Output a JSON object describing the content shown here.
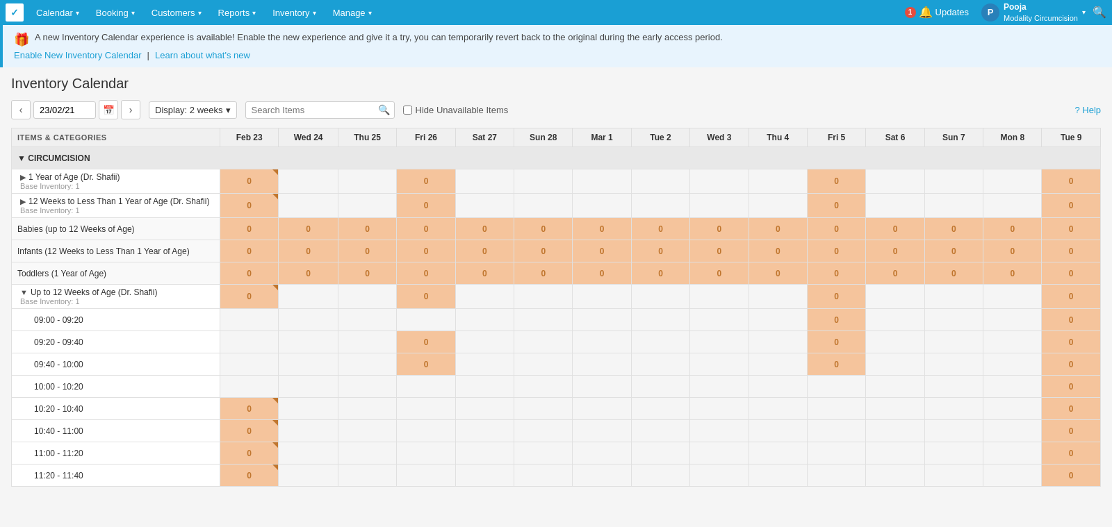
{
  "nav": {
    "logo": "✓",
    "items": [
      {
        "label": "Calendar",
        "id": "calendar"
      },
      {
        "label": "Booking",
        "id": "booking"
      },
      {
        "label": "Customers",
        "id": "customers"
      },
      {
        "label": "Reports",
        "id": "reports"
      },
      {
        "label": "Inventory",
        "id": "inventory"
      },
      {
        "label": "Manage",
        "id": "manage"
      }
    ],
    "updates_label": "Updates",
    "updates_count": "1",
    "user_name": "Pooja",
    "user_org": "Modality Circumcision",
    "user_initial": "P"
  },
  "banner": {
    "message": "A new Inventory Calendar experience is available! Enable the new experience and give it a try, you can temporarily revert back to the original during the early access period.",
    "link1": "Enable New Inventory Calendar",
    "separator": "|",
    "link2": "Learn about what's new"
  },
  "page": {
    "title": "Inventory Calendar",
    "date_value": "23/02/21",
    "display_label": "Display: 2 weeks",
    "search_placeholder": "Search Items",
    "hide_label": "Hide Unavailable Items",
    "help_label": "? Help"
  },
  "calendar": {
    "column_headers": [
      {
        "label": "ITEMS & CATEGORIES",
        "id": "items-col"
      },
      {
        "label": "Feb 23",
        "id": "feb23"
      },
      {
        "label": "Wed 24",
        "id": "wed24"
      },
      {
        "label": "Thu 25",
        "id": "thu25"
      },
      {
        "label": "Fri 26",
        "id": "fri26"
      },
      {
        "label": "Sat 27",
        "id": "sat27"
      },
      {
        "label": "Sun 28",
        "id": "sun28"
      },
      {
        "label": "Mar 1",
        "id": "mar1"
      },
      {
        "label": "Tue 2",
        "id": "tue2"
      },
      {
        "label": "Wed 3",
        "id": "wed3"
      },
      {
        "label": "Thu 4",
        "id": "thu4"
      },
      {
        "label": "Fri 5",
        "id": "fri5"
      },
      {
        "label": "Sat 6",
        "id": "sat6"
      },
      {
        "label": "Sun 7",
        "id": "sun7"
      },
      {
        "label": "Mon 8",
        "id": "mon8"
      },
      {
        "label": "Tue 9",
        "id": "tue9"
      }
    ],
    "category": "CIRCUMCISION",
    "rows": [
      {
        "type": "item",
        "name": "1 Year of Age (Dr. Shafii)",
        "base": "Base Inventory: 1",
        "expandable": true,
        "cells": [
          "0",
          "",
          "",
          "0",
          "",
          "",
          "",
          "",
          "",
          "",
          "0",
          "",
          "",
          "",
          "0"
        ],
        "orange": [
          0,
          3,
          10,
          14
        ],
        "corner": [
          0
        ]
      },
      {
        "type": "item",
        "name": "12 Weeks to Less Than 1 Year of Age (Dr. Shafii)",
        "base": "Base Inventory: 1",
        "expandable": true,
        "cells": [
          "0",
          "",
          "",
          "0",
          "",
          "",
          "",
          "",
          "",
          "",
          "0",
          "",
          "",
          "",
          "0"
        ],
        "orange": [
          0,
          3,
          10,
          14
        ],
        "corner": [
          0
        ]
      },
      {
        "type": "sub",
        "name": "Babies (up to 12 Weeks of Age)",
        "cells": [
          "0",
          "0",
          "0",
          "0",
          "0",
          "0",
          "0",
          "0",
          "0",
          "0",
          "0",
          "0",
          "0",
          "0",
          "0"
        ],
        "orange": [
          0,
          1,
          2,
          3,
          4,
          5,
          6,
          7,
          8,
          9,
          10,
          11,
          12,
          13,
          14
        ],
        "corner": []
      },
      {
        "type": "sub",
        "name": "Infants (12 Weeks to Less Than 1 Year of Age)",
        "cells": [
          "0",
          "0",
          "0",
          "0",
          "0",
          "0",
          "0",
          "0",
          "0",
          "0",
          "0",
          "0",
          "0",
          "0",
          "0"
        ],
        "orange": [
          0,
          1,
          2,
          3,
          4,
          5,
          6,
          7,
          8,
          9,
          10,
          11,
          12,
          13,
          14
        ],
        "corner": []
      },
      {
        "type": "sub",
        "name": "Toddlers (1 Year of Age)",
        "cells": [
          "0",
          "0",
          "0",
          "0",
          "0",
          "0",
          "0",
          "0",
          "0",
          "0",
          "0",
          "0",
          "0",
          "0",
          "0"
        ],
        "orange": [
          0,
          1,
          2,
          3,
          4,
          5,
          6,
          7,
          8,
          9,
          10,
          11,
          12,
          13,
          14
        ],
        "corner": []
      },
      {
        "type": "item",
        "name": "Up to 12 Weeks of Age (Dr. Shafii)",
        "base": "Base Inventory: 1",
        "expandable": true,
        "expanded": true,
        "cells": [
          "0",
          "",
          "",
          "0",
          "",
          "",
          "",
          "",
          "",
          "",
          "0",
          "",
          "",
          "",
          "0"
        ],
        "orange": [
          0,
          3,
          10,
          14
        ],
        "corner": [
          0
        ]
      },
      {
        "type": "timeslot",
        "name": "09:00 - 09:20",
        "cells": [
          "",
          "",
          "",
          "",
          "",
          "",
          "",
          "",
          "",
          "",
          "0",
          "",
          "",
          "",
          "0"
        ],
        "orange": [
          10,
          14
        ],
        "corner": []
      },
      {
        "type": "timeslot",
        "name": "09:20 - 09:40",
        "cells": [
          "",
          "",
          "",
          "0",
          "",
          "",
          "",
          "",
          "",
          "",
          "0",
          "",
          "",
          "",
          "0"
        ],
        "orange": [
          3,
          10,
          14
        ],
        "corner": []
      },
      {
        "type": "timeslot",
        "name": "09:40 - 10:00",
        "cells": [
          "",
          "",
          "",
          "0",
          "",
          "",
          "",
          "",
          "",
          "",
          "0",
          "",
          "",
          "",
          "0"
        ],
        "orange": [
          3,
          10,
          14
        ],
        "corner": []
      },
      {
        "type": "timeslot",
        "name": "10:00 - 10:20",
        "cells": [
          "",
          "",
          "",
          "",
          "",
          "",
          "",
          "",
          "",
          "",
          "",
          "",
          "",
          "",
          "0"
        ],
        "orange": [
          14
        ],
        "corner": []
      },
      {
        "type": "timeslot",
        "name": "10:20 - 10:40",
        "cells": [
          "0",
          "",
          "",
          "",
          "",
          "",
          "",
          "",
          "",
          "",
          "",
          "",
          "",
          "",
          "0"
        ],
        "orange": [
          0,
          14
        ],
        "corner": [
          0
        ]
      },
      {
        "type": "timeslot",
        "name": "10:40 - 11:00",
        "cells": [
          "0",
          "",
          "",
          "",
          "",
          "",
          "",
          "",
          "",
          "",
          "",
          "",
          "",
          "",
          "0"
        ],
        "orange": [
          0,
          14
        ],
        "corner": [
          0
        ]
      },
      {
        "type": "timeslot",
        "name": "11:00 - 11:20",
        "cells": [
          "0",
          "",
          "",
          "",
          "",
          "",
          "",
          "",
          "",
          "",
          "",
          "",
          "",
          "",
          "0"
        ],
        "orange": [
          0,
          14
        ],
        "corner": [
          0
        ]
      },
      {
        "type": "timeslot",
        "name": "11:20 - 11:40",
        "cells": [
          "0",
          "",
          "",
          "",
          "",
          "",
          "",
          "",
          "",
          "",
          "",
          "",
          "",
          "",
          "0"
        ],
        "orange": [
          0,
          14
        ],
        "corner": [
          0
        ]
      }
    ]
  }
}
